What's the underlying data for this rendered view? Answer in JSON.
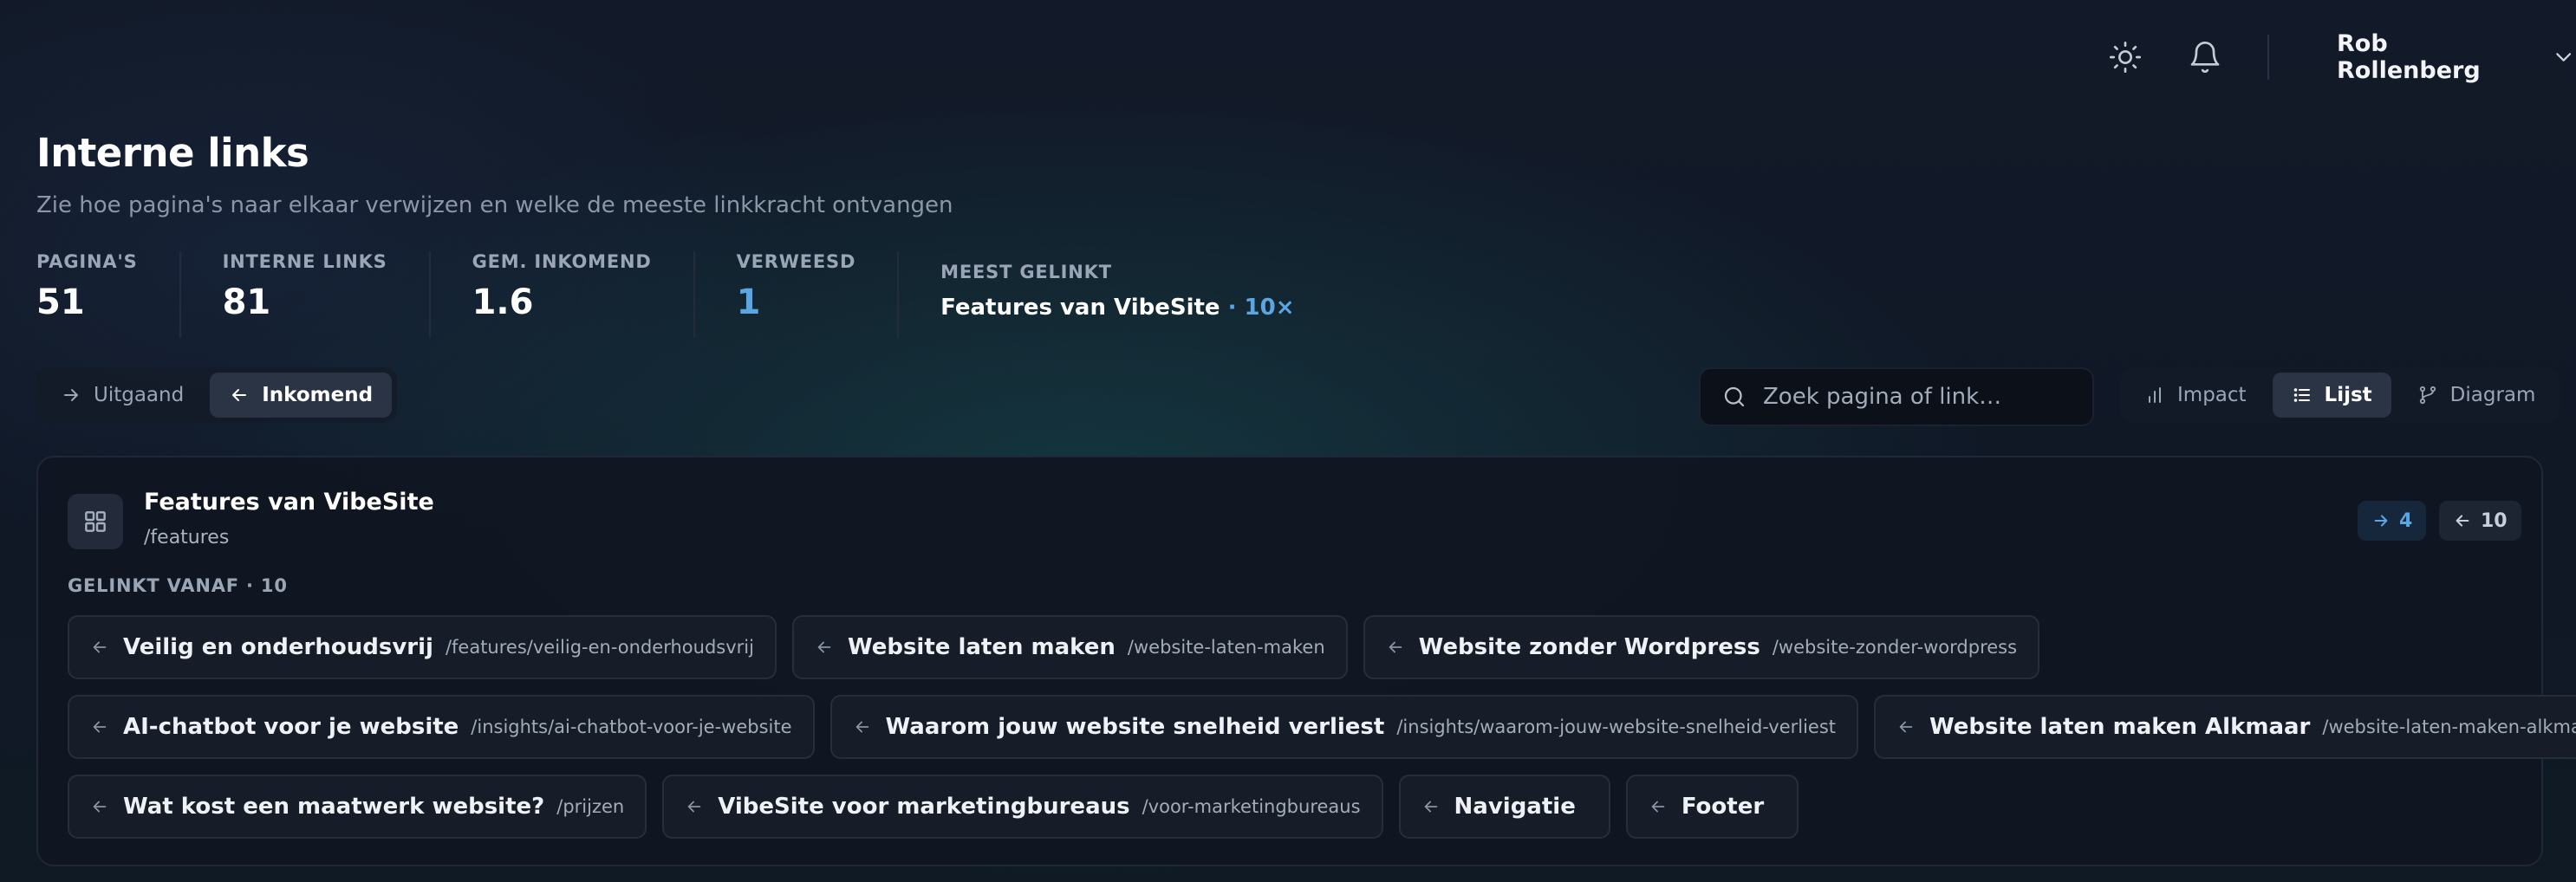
{
  "topbar": {
    "user_name": "Rob Rollenberg",
    "icons": [
      "sun-icon",
      "bell-icon",
      "chevron-down-icon"
    ]
  },
  "header": {
    "title": "Interne links",
    "subtitle": "Zie hoe pagina's naar elkaar verwijzen en welke de meeste linkkracht ontvangen"
  },
  "stats": {
    "pages_label": "PAGINA'S",
    "pages_value": "51",
    "links_label": "INTERNE LINKS",
    "links_value": "81",
    "avg_label": "GEM. INKOMEND",
    "avg_value": "1.6",
    "orphan_label": "VERWEESD",
    "orphan_value": "1",
    "top_label": "MEEST GELINKT",
    "top_page": "Features van VibeSite",
    "top_count": " · 10×"
  },
  "direction_toggle": {
    "outgoing": "Uitgaand",
    "incoming": "Inkomend",
    "active": "incoming"
  },
  "search": {
    "placeholder": "Zoek pagina of link…"
  },
  "view_toggle": {
    "impact": "Impact",
    "list": "Lijst",
    "diagram": "Diagram",
    "active": "list"
  },
  "card": {
    "title": "Features van VibeSite",
    "path": "/features",
    "outgoing_count": "4",
    "incoming_count": "10",
    "section_label": "GELINKT VANAF · 10",
    "rows": [
      [
        {
          "title": "Veilig en onderhoudsvrij",
          "path": "/features/veilig-en-onderhoudsvrij"
        },
        {
          "title": "Website laten maken",
          "path": "/website-laten-maken"
        },
        {
          "title": "Website zonder Wordpress",
          "path": "/website-zonder-wordpress"
        }
      ],
      [
        {
          "title": "AI-chatbot voor je website",
          "path": "/insights/ai-chatbot-voor-je-website"
        },
        {
          "title": "Waarom jouw website snelheid verliest",
          "path": "/insights/waarom-jouw-website-snelheid-verliest"
        },
        {
          "title": "Website laten maken Alkmaar",
          "path": "/website-laten-maken-alkmaar"
        }
      ],
      [
        {
          "title": "Wat kost een maatwerk website?",
          "path": "/prijzen"
        },
        {
          "title": "VibeSite voor marketingbureaus",
          "path": "/voor-marketingbureaus"
        },
        {
          "title": "Navigatie",
          "path": ""
        },
        {
          "title": "Footer",
          "path": ""
        }
      ]
    ]
  },
  "colors": {
    "accent": "#5aa5e2",
    "background": "#121a29",
    "card": "#111621",
    "chip": "#161c28"
  }
}
